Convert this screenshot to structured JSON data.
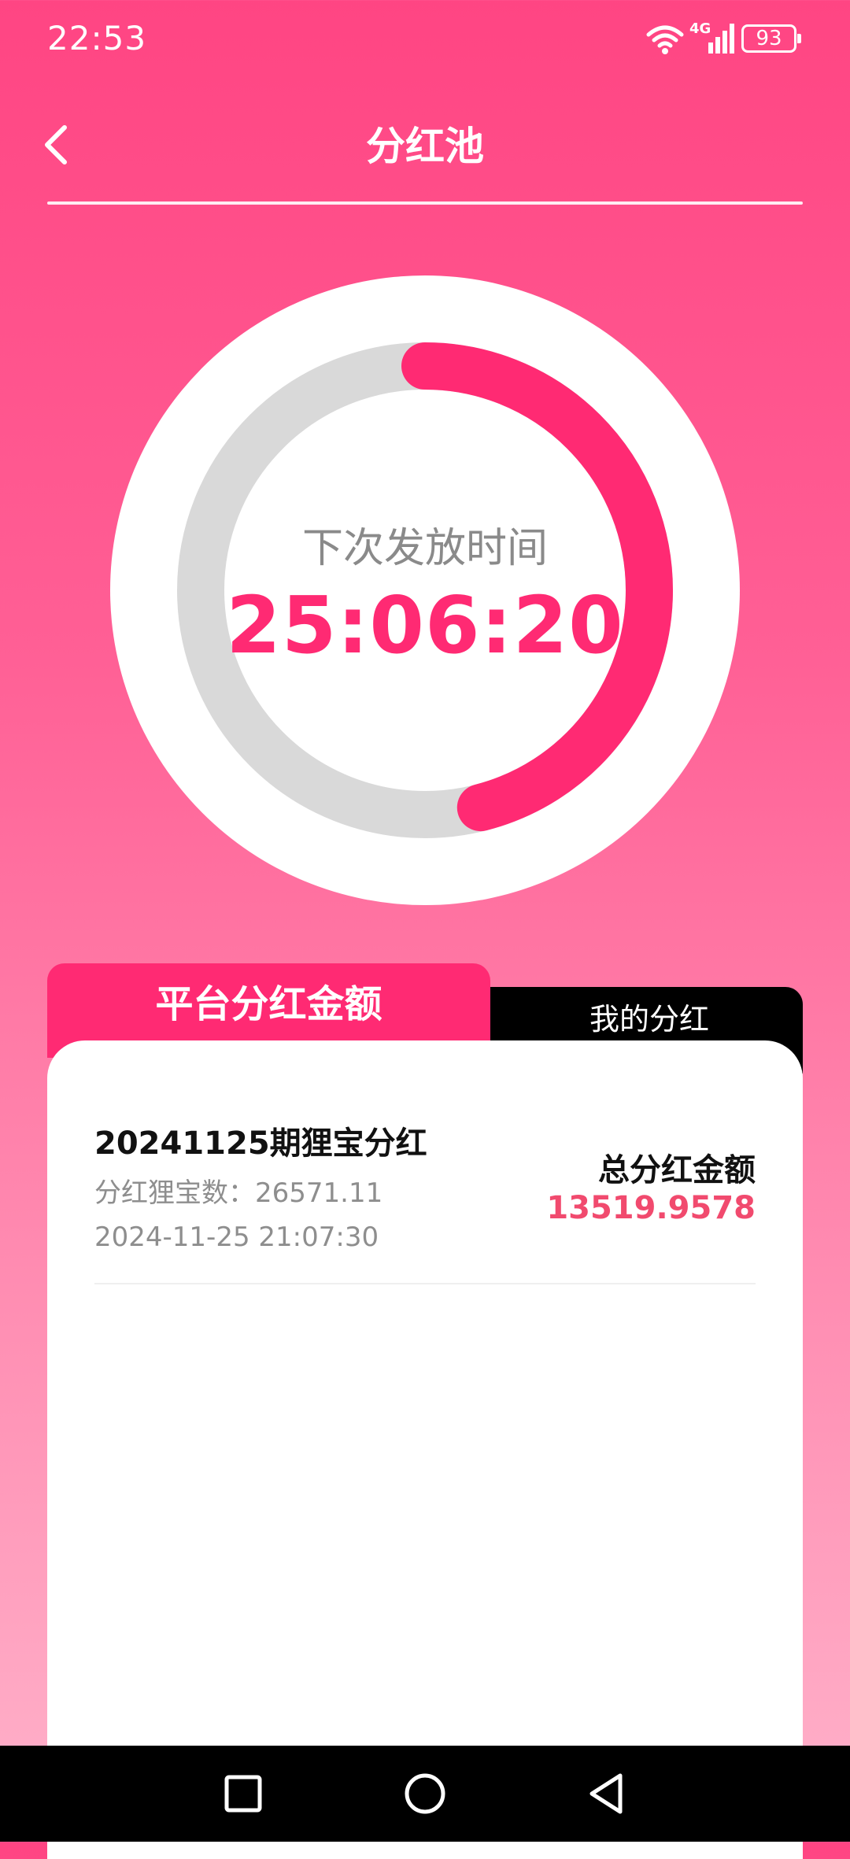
{
  "status_bar": {
    "time": "22:53",
    "network": "4G",
    "battery": "93",
    "icons": [
      "wifi-icon",
      "signal-icon",
      "battery-icon"
    ]
  },
  "header": {
    "title": "分红池",
    "back_icon": "chevron-left-icon"
  },
  "countdown": {
    "label": "下次发放时间",
    "value": "25:06:20",
    "progress_fraction": 0.46,
    "colors": {
      "track": "#d9d9d9",
      "progress": "#ff2a73",
      "text": "#ff2a73"
    }
  },
  "tabs": [
    {
      "label": "平台分红金额",
      "active": true
    },
    {
      "label": "我的分红",
      "active": false
    }
  ],
  "records": [
    {
      "title": "20241125期狸宝分红",
      "count_label": "分红狸宝数：26571.11",
      "time": "2024-11-25 21:07:30",
      "total_label": "总分红金额",
      "total_value": "13519.9578"
    }
  ],
  "nav_bar": {
    "icons": [
      "recent-apps-icon",
      "home-icon",
      "back-triangle-icon"
    ]
  },
  "colors": {
    "accent": "#ff2a73",
    "background_top": "#ff4583",
    "background_bottom": "#ffb2ca",
    "amount": "#f14a6e"
  }
}
